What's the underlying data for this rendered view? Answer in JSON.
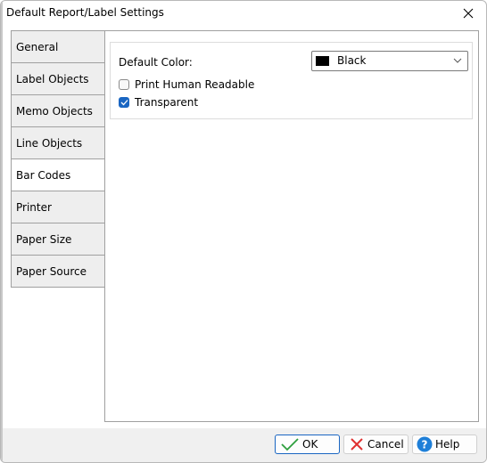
{
  "window": {
    "title": "Default Report/Label Settings"
  },
  "tabs": [
    {
      "label": "General",
      "selected": false
    },
    {
      "label": "Label Objects",
      "selected": false
    },
    {
      "label": "Memo Objects",
      "selected": false
    },
    {
      "label": "Line Objects",
      "selected": false
    },
    {
      "label": "Bar Codes",
      "selected": true
    },
    {
      "label": "Printer",
      "selected": false
    },
    {
      "label": "Paper Size",
      "selected": false
    },
    {
      "label": "Paper Source",
      "selected": false
    }
  ],
  "barcodes": {
    "default_color_label": "Default Color:",
    "default_color_value": "Black",
    "default_color_swatch": "#000000",
    "print_human_readable": {
      "label": "Print Human Readable",
      "checked": false
    },
    "transparent": {
      "label": "Transparent",
      "checked": true
    }
  },
  "footer": {
    "ok_label": "OK",
    "cancel_label": "Cancel",
    "help_label": "Help"
  },
  "colors": {
    "accent": "#1a66c2",
    "ok_check": "#2e9e3e",
    "cancel_x": "#e03030",
    "help_circle": "#1e7fd8"
  },
  "icons": {
    "close": "close-icon",
    "dropdown": "chevron-down-icon",
    "ok": "checkmark-icon",
    "cancel": "x-icon",
    "help": "question-mark-icon"
  }
}
